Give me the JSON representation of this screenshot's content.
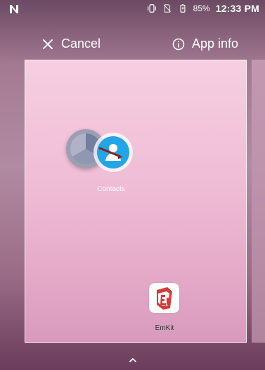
{
  "status": {
    "battery_percent": "85%",
    "time": "12:33 PM",
    "icons": [
      "notification-n-icon",
      "vibrate-icon",
      "no-sim-icon",
      "battery-icon"
    ]
  },
  "top": {
    "cancel_label": "Cancel",
    "app_info_label": "App info"
  },
  "apps": {
    "contacts_label": "Contacts",
    "emkit_label": "EmKit"
  },
  "colors": {
    "accent_blue": "#22a6e8",
    "emkit_red": "#d63a3a"
  }
}
